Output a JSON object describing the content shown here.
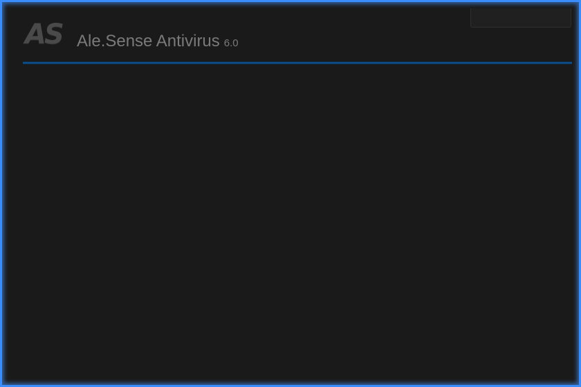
{
  "app": {
    "logo_text": "AS",
    "title": "Ale.Sense Antivirus",
    "version": "6.0"
  },
  "colors": {
    "background": "#1a1a1a",
    "accent": "#0f4f8c",
    "window_border": "#3a8cff"
  }
}
